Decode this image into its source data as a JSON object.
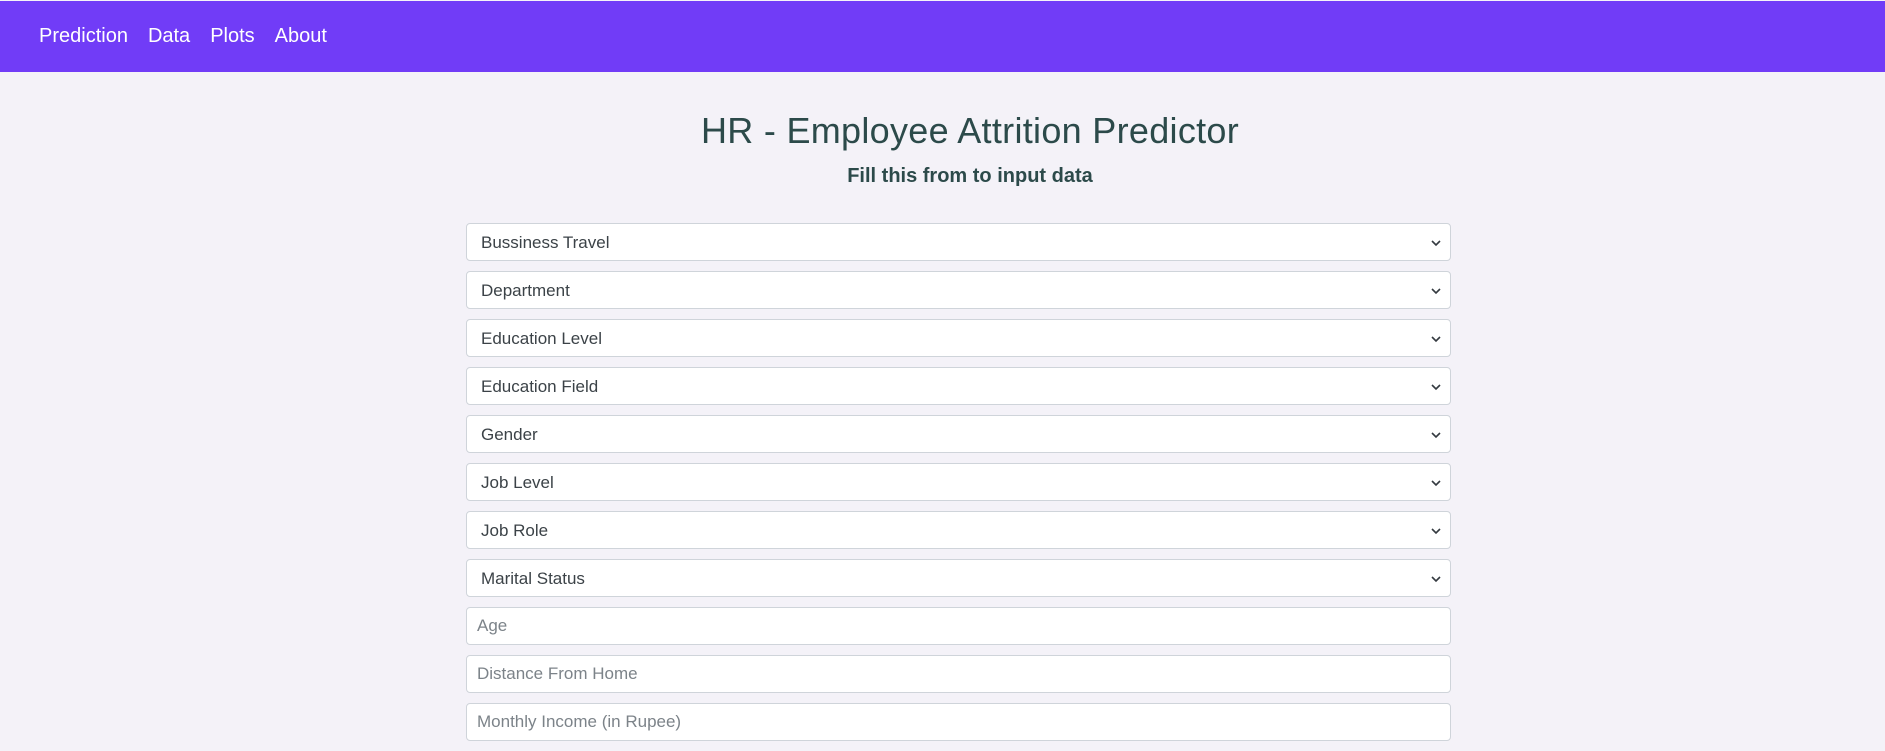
{
  "nav": {
    "items": [
      "Prediction",
      "Data",
      "Plots",
      "About"
    ]
  },
  "page": {
    "title": "HR - Employee Attrition Predictor",
    "subtitle": "Fill this from to input data"
  },
  "form": {
    "selects": [
      "Bussiness Travel",
      "Department",
      "Education Level",
      "Education Field",
      "Gender",
      "Job Level",
      "Job Role",
      "Marital Status"
    ],
    "inputs": [
      {
        "placeholder": "Age",
        "value": ""
      },
      {
        "placeholder": "Distance From Home",
        "value": ""
      },
      {
        "placeholder": "Monthly Income (in Rupee)",
        "value": ""
      }
    ]
  },
  "colors": {
    "navbar": "#713cf7",
    "title_text": "#2c4a4a",
    "background": "#f4f2f8"
  },
  "icons": {
    "select_arrow": "chevron-down-icon"
  }
}
